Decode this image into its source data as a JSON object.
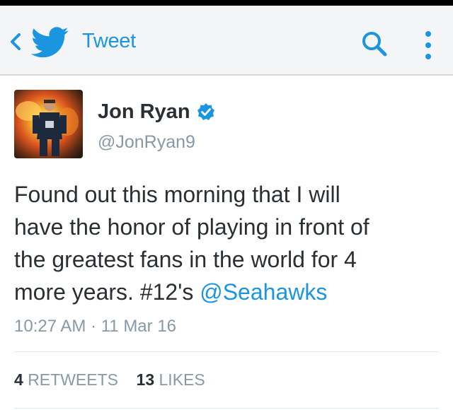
{
  "app_bar": {
    "title": "Tweet",
    "icons": {
      "back": "chevron-left-icon",
      "logo": "twitter-bird-icon",
      "search": "search-icon",
      "more": "more-vertical-icon"
    }
  },
  "tweet": {
    "author_name": "Jon Ryan",
    "author_handle": "@JonRyan9",
    "verified": true,
    "text_parts": {
      "line1": "Found out this morning that I will",
      "line2": "have the honor of playing in front of",
      "line3": "the greatest fans in the world for 4",
      "line4_prefix": "more years. #12's ",
      "mention": "@Seahawks"
    },
    "timestamp": "10:27 AM · 11 Mar 16",
    "stats": {
      "retweets_count": "4",
      "retweets_label": "RETWEETS",
      "likes_count": "13",
      "likes_label": "LIKES"
    }
  },
  "colors": {
    "accent": "#1b95e0",
    "text": "#292f33",
    "muted": "#8899a6",
    "app_bar_bg": "#f4f5f7"
  }
}
